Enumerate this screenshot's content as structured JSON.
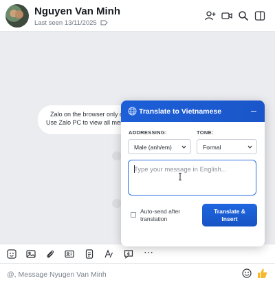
{
  "header": {
    "contact_name": "Nguyen Van Minh",
    "last_seen": "Last seen 13/11/2025",
    "icons": [
      "add-member-icon",
      "video-call-icon",
      "search-icon",
      "sidebar-toggle-icon"
    ]
  },
  "chat": {
    "system_notice_line1": "Zalo on the browser only di",
    "system_notice_line2": "Use Zalo PC to view all messag"
  },
  "toolbar": {
    "icons": [
      "sticker-icon",
      "image-icon",
      "attachment-icon",
      "contact-card-icon",
      "screenshot-icon",
      "text-format-icon",
      "quick-message-icon",
      "more-icon"
    ],
    "more_label": "⋯"
  },
  "composer": {
    "placeholder": "@, Message Nyugen Van Minh",
    "value": ""
  },
  "translate_popup": {
    "title": "Translate to Vietnamese",
    "minimize_label": "–",
    "addressing_label": "ADDRESSING:",
    "addressing_value": "Male (anh/em)",
    "tone_label": "TONE:",
    "tone_value": "Formal",
    "textarea_placeholder": "Type your message in English...",
    "auto_send_label": "Auto-send after translation",
    "auto_send_checked": false,
    "action_label_line1": "Translate &",
    "action_label_line2": "Insert"
  },
  "colors": {
    "accent": "#1d5fd8",
    "chat_background": "#ebecf0",
    "like_icon": "#f5b82e"
  }
}
